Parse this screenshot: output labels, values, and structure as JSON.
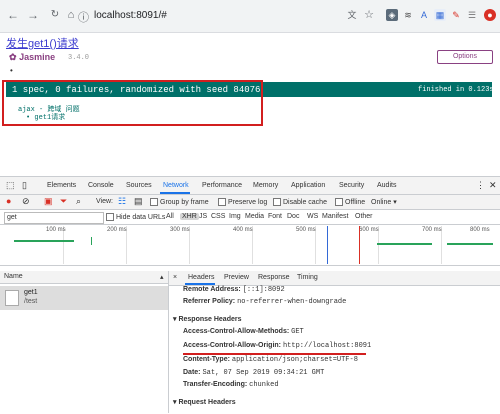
{
  "browser": {
    "url": "localhost:8091/#"
  },
  "page": {
    "link_text": "发生get1()请求",
    "jasmine_logo": "Jasmine",
    "jasmine_version": "3.4.0",
    "options_label": "Options",
    "dot": "•",
    "result_summary": "1 spec, 0 failures, randomized with seed 84076",
    "result_time": "finished in 0.123s",
    "suite": "ajax - 跨域 问题",
    "spec": "• get1请求"
  },
  "devtools": {
    "tabs": [
      "Elements",
      "Console",
      "Sources",
      "Network",
      "Performance",
      "Memory",
      "Application",
      "Security",
      "Audits"
    ],
    "toolbar": {
      "view_label": "View:",
      "group_by_frame": "Group by frame",
      "preserve_log": "Preserve log",
      "disable_cache": "Disable cache",
      "offline": "Offline",
      "online": "Online"
    },
    "filter": {
      "value": "get",
      "hide_data_urls": "Hide data URLs",
      "types": [
        "All",
        "XHR",
        "JS",
        "CSS",
        "Img",
        "Media",
        "Font",
        "Doc",
        "WS",
        "Manifest",
        "Other"
      ]
    },
    "timeline_ticks": [
      "100 ms",
      "200 ms",
      "300 ms",
      "400 ms",
      "500 ms",
      "600 ms",
      "700 ms",
      "800 ms"
    ],
    "list": {
      "name_header": "Name",
      "request_name": "get1",
      "request_path": "/test"
    },
    "detail": {
      "close": "×",
      "tabs": [
        "Headers",
        "Preview",
        "Response",
        "Timing"
      ],
      "general": [
        {
          "key": "Remote Address:",
          "value": "[::1]:8092"
        },
        {
          "key": "Referrer Policy:",
          "value": "no-referrer-when-downgrade"
        }
      ],
      "response_headers_title": "▾ Response Headers",
      "response_headers": [
        {
          "key": "Access-Control-Allow-Methods:",
          "value": "GET"
        },
        {
          "key": "Access-Control-Allow-Origin:",
          "value": "http://localhost:8091"
        },
        {
          "key": "Content-Type:",
          "value": "application/json;charset=UTF-8"
        },
        {
          "key": "Date:",
          "value": "Sat, 07 Sep 2019 09:34:21 GMT"
        },
        {
          "key": "Transfer-Encoding:",
          "value": "chunked"
        }
      ],
      "request_headers_title": "▾ Request Headers"
    }
  },
  "colors": {
    "jasmine_purple": "#8a4182",
    "result_green": "#007069",
    "highlight_red": "#d21f1f",
    "devtools_blue": "#1a73e8"
  }
}
